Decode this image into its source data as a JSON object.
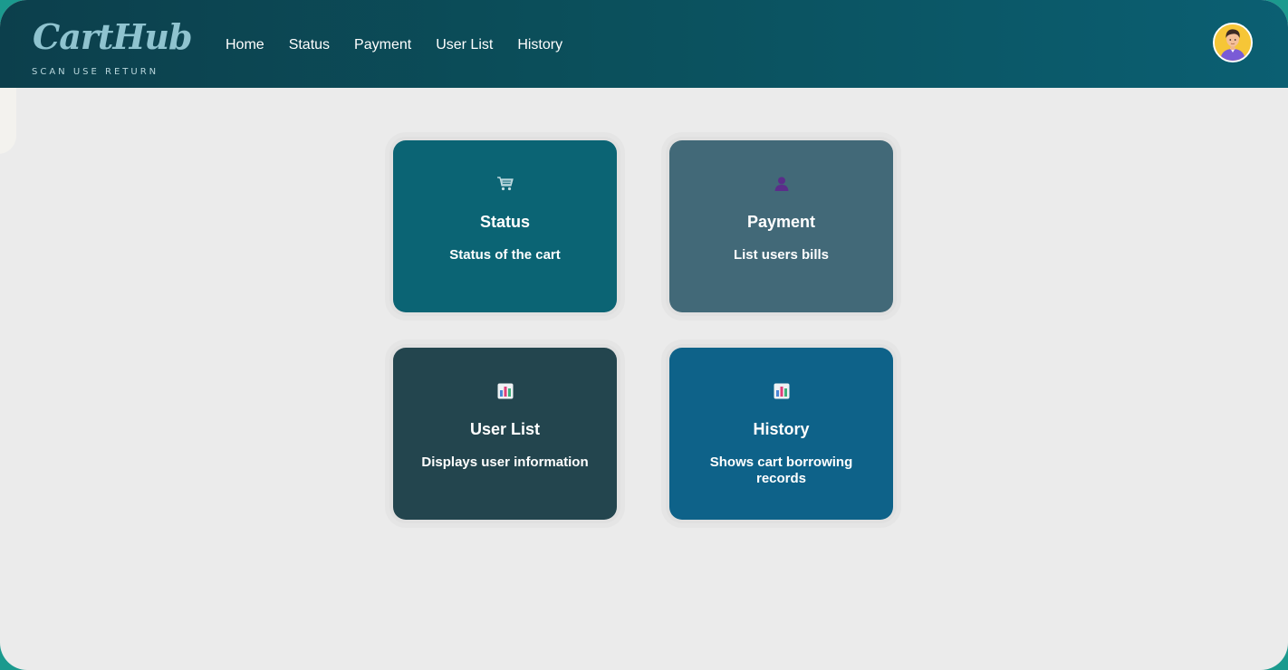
{
  "brand": {
    "name": "CartHub",
    "tagline": "SCAN USE RETURN"
  },
  "nav": {
    "items": [
      "Home",
      "Status",
      "Payment",
      "User List",
      "History"
    ]
  },
  "cards": [
    {
      "icon": "shopping-cart-icon",
      "title": "Status",
      "description": "Status of the cart",
      "color": "#0b6474"
    },
    {
      "icon": "user-icon",
      "title": "Payment",
      "description": "List users bills",
      "color": "#426978"
    },
    {
      "icon": "bar-chart-icon",
      "title": "User List",
      "description": "Displays user information",
      "color": "#23454e"
    },
    {
      "icon": "bar-chart-icon",
      "title": "History",
      "description": "Shows cart borrowing records",
      "color": "#0e6289"
    }
  ],
  "colors": {
    "header_start": "#0c3f4c",
    "header_end": "#0b5f72",
    "background": "#ebebeb",
    "accent_border": "#1b9a8e"
  }
}
